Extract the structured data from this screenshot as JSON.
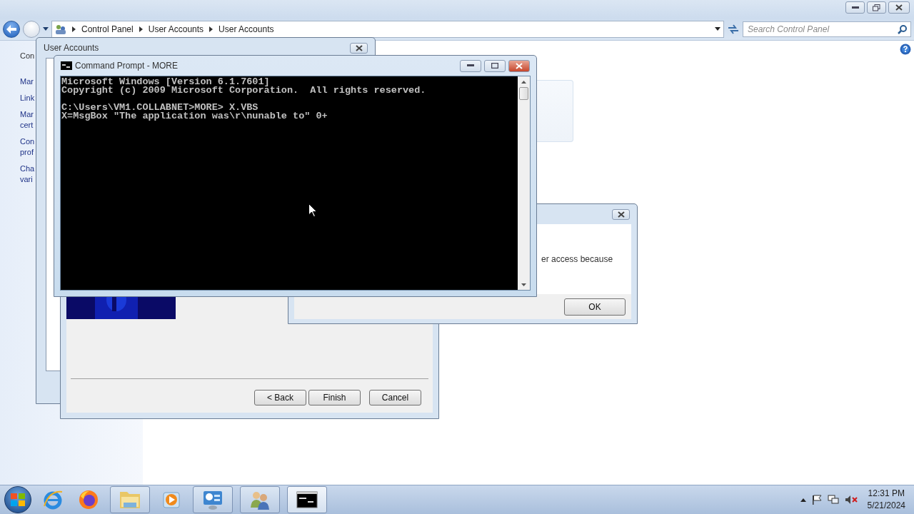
{
  "explorer": {
    "breadcrumb": [
      "Control Panel",
      "User Accounts",
      "User Accounts"
    ],
    "search": {
      "placeholder": "Search Control Panel"
    },
    "sidebar": {
      "items": [
        "Con",
        "Mar",
        "Link",
        "Mar\ncert",
        "Con\nprof",
        "Cha\nvari"
      ]
    }
  },
  "user_accounts_window": {
    "title": "User Accounts"
  },
  "wizard": {
    "buttons": [
      "< Back",
      "Finish",
      "Cancel"
    ]
  },
  "message_dialog": {
    "text": "er access because",
    "buttons": [
      "OK"
    ]
  },
  "command_prompt": {
    "title": "Command Prompt - MORE",
    "blocks": [
      [
        "Microsoft Windows [Version 6.1.7601]",
        "Copyright (c) 2009 Microsoft Corporation.  All rights reserved."
      ],
      [
        "C:\\Users\\VM1.COLLABNET>MORE> X.VBS",
        "X=MsgBox \"The application was\\r\\nunable to\" 0+"
      ]
    ]
  },
  "taskbar": {
    "apps": [
      {
        "kind": "ie",
        "running": false,
        "selected": false
      },
      {
        "kind": "firefox",
        "running": false,
        "selected": false
      },
      {
        "kind": "folder",
        "running": true,
        "selected": false
      },
      {
        "kind": "media",
        "running": false,
        "selected": false
      },
      {
        "kind": "control",
        "running": true,
        "selected": false
      },
      {
        "kind": "users",
        "running": true,
        "selected": false
      },
      {
        "kind": "cmd",
        "running": true,
        "selected": true
      }
    ],
    "time": "12:31 PM",
    "date": "5/21/2024"
  }
}
